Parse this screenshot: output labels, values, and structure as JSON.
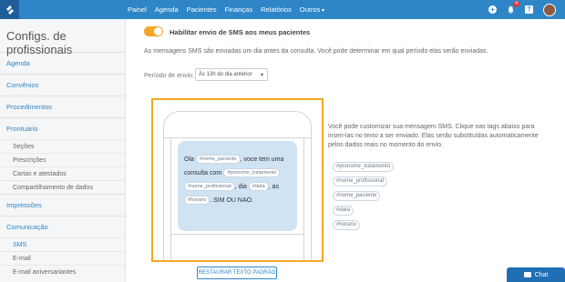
{
  "nav": {
    "items": [
      "Painel",
      "Agenda",
      "Pacientes",
      "Finanças",
      "Relatórios",
      "Outros"
    ],
    "notification_count": "4",
    "help_label": "?",
    "add_label": "+"
  },
  "sidebar": {
    "title": "Configs. de profissionais",
    "agenda": "Agenda",
    "convenios": "Convênios",
    "procedimentos": "Procedimentos",
    "prontuario": "Prontuário",
    "prontuario_items": [
      "Seções",
      "Prescrições",
      "Cartas e atestados",
      "Compartilhamento de dados"
    ],
    "impressoes": "Impressões",
    "comunicacao": "Comunicação",
    "comunicacao_items": [
      "SMS",
      "E-mail",
      "E-mail aniversariantes"
    ]
  },
  "sms": {
    "enable_label": "Habilitar envio de SMS aos meus pacientes",
    "enabled": true,
    "description": "As mensagens SMS são enviadas um dia antes da consulta. Você pode determinar em qual período elas serão enviadas.",
    "period_label": "Período de envio:",
    "period_value": "Às 13h do dia anterior",
    "message": {
      "t1": "Ola",
      "tag1": "#nome_paciente",
      "t2": ", voce tem uma consulta com",
      "tag2": "#pronome_tratamento",
      "tag3": "#nome_profissional",
      "t3": ", dia",
      "tag4": "#data",
      "t4": ", as",
      "tag5": "#horario",
      "t5": ". SIM OU NAO."
    },
    "restore_label": "RESTAURAR TEXTO PADRÃO",
    "custom_text": "Você pode customizar sua mensagem SMS. Clique nas tags abaixo para inseri-las no texto a ser enviado. Elas serão substituídas automaticamente pelos dados reais no momento do envio.",
    "tags": [
      "#pronome_tratamento",
      "#nome_profissional",
      "#nome_paciente",
      "#data",
      "#horario"
    ]
  },
  "chat": {
    "label": "Chat"
  },
  "colors": {
    "topbar": "#2e86c8",
    "accent": "#f5a623",
    "bubble": "#cfe3f3"
  }
}
